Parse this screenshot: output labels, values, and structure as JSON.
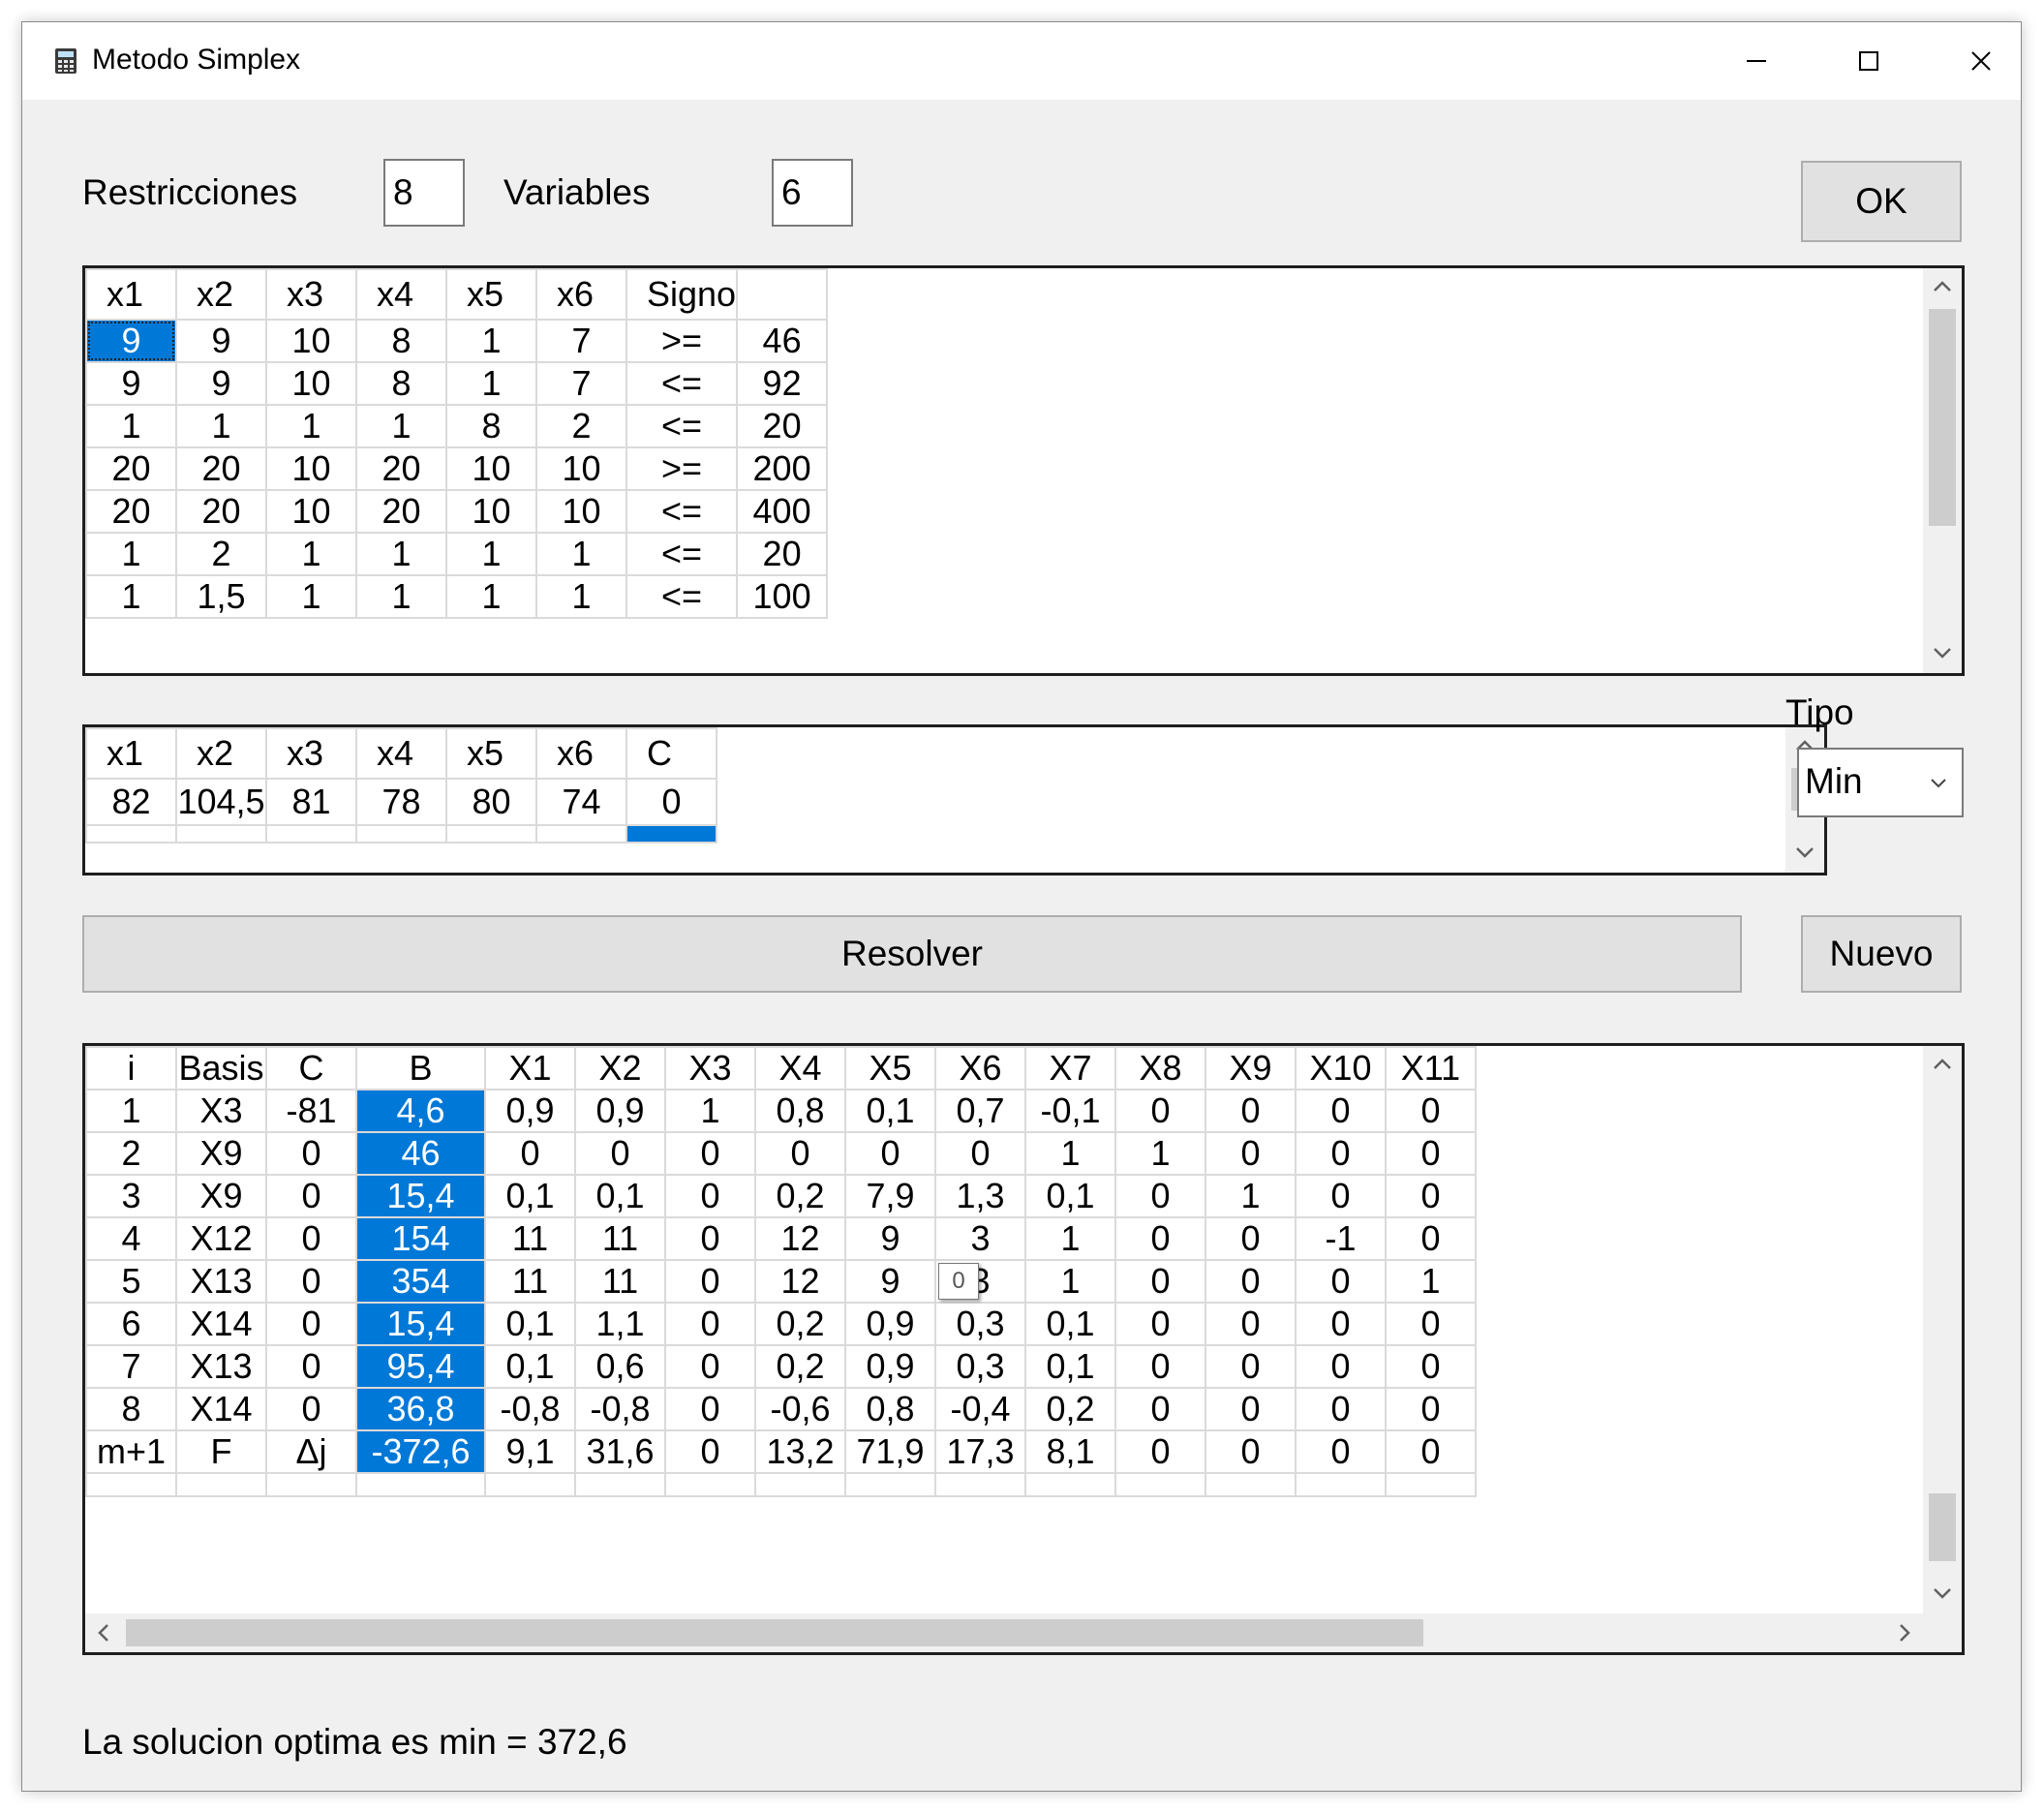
{
  "window": {
    "title": "Metodo Simplex",
    "minimize": "minimize",
    "maximize": "maximize",
    "close": "close"
  },
  "config": {
    "restricciones_label": "Restricciones",
    "restricciones_value": "8",
    "variables_label": "Variables",
    "variables_value": "6",
    "ok_label": "OK"
  },
  "constraints": {
    "headers": [
      "x1",
      "x2",
      "x3",
      "x4",
      "x5",
      "x6",
      "Signo",
      ""
    ],
    "rows": [
      [
        "9",
        "9",
        "10",
        "8",
        "1",
        "7",
        ">=",
        "46"
      ],
      [
        "9",
        "9",
        "10",
        "8",
        "1",
        "7",
        "<=",
        "92"
      ],
      [
        "1",
        "1",
        "1",
        "1",
        "8",
        "2",
        "<=",
        "20"
      ],
      [
        "20",
        "20",
        "10",
        "20",
        "10",
        "10",
        ">=",
        "200"
      ],
      [
        "20",
        "20",
        "10",
        "20",
        "10",
        "10",
        "<=",
        "400"
      ],
      [
        "1",
        "2",
        "1",
        "1",
        "1",
        "1",
        "<=",
        "20"
      ],
      [
        "1",
        "1,5",
        "1",
        "1",
        "1",
        "1",
        "<=",
        "100"
      ]
    ]
  },
  "objective": {
    "headers": [
      "x1",
      "x2",
      "x3",
      "x4",
      "x5",
      "x6",
      "C"
    ],
    "values": [
      "82",
      "104,5",
      "81",
      "78",
      "80",
      "74",
      "0"
    ]
  },
  "tipo": {
    "label": "Tipo",
    "selected": "Min"
  },
  "actions": {
    "resolver_label": "Resolver",
    "nuevo_label": "Nuevo"
  },
  "simplex": {
    "headers": [
      "i",
      "Basis",
      "C",
      "B",
      "X1",
      "X2",
      "X3",
      "X4",
      "X5",
      "X6",
      "X7",
      "X8",
      "X9",
      "X10",
      "X11"
    ],
    "rows": [
      [
        "1",
        "X3",
        "-81",
        "4,6",
        "0,9",
        "0,9",
        "1",
        "0,8",
        "0,1",
        "0,7",
        "-0,1",
        "0",
        "0",
        "0",
        "0"
      ],
      [
        "2",
        "X9",
        "0",
        "46",
        "0",
        "0",
        "0",
        "0",
        "0",
        "0",
        "1",
        "1",
        "0",
        "0",
        "0"
      ],
      [
        "3",
        "X9",
        "0",
        "15,4",
        "0,1",
        "0,1",
        "0",
        "0,2",
        "7,9",
        "1,3",
        "0,1",
        "0",
        "1",
        "0",
        "0"
      ],
      [
        "4",
        "X12",
        "0",
        "154",
        "11",
        "11",
        "0",
        "12",
        "9",
        "3",
        "1",
        "0",
        "0",
        "-1",
        "0"
      ],
      [
        "5",
        "X13",
        "0",
        "354",
        "11",
        "11",
        "0",
        "12",
        "9",
        "3",
        "1",
        "0",
        "0",
        "0",
        "1"
      ],
      [
        "6",
        "X14",
        "0",
        "15,4",
        "0,1",
        "1,1",
        "0",
        "0,2",
        "0,9",
        "0,3",
        "0,1",
        "0",
        "0",
        "0",
        "0"
      ],
      [
        "7",
        "X13",
        "0",
        "95,4",
        "0,1",
        "0,6",
        "0",
        "0,2",
        "0,9",
        "0,3",
        "0,1",
        "0",
        "0",
        "0",
        "0"
      ],
      [
        "8",
        "X14",
        "0",
        "36,8",
        "-0,8",
        "-0,8",
        "0",
        "-0,6",
        "0,8",
        "-0,4",
        "0,2",
        "0",
        "0",
        "0",
        "0"
      ],
      [
        "m+1",
        "F",
        "Δj",
        "-372,6",
        "9,1",
        "31,6",
        "0",
        "13,2",
        "71,9",
        "17,3",
        "8,1",
        "0",
        "0",
        "0",
        "0"
      ]
    ],
    "tooltip": "0"
  },
  "result_text": "La solucion optima es min = 372,6",
  "colors": {
    "selection": "#0078d7",
    "window_bg": "#f0f0f0",
    "button_bg": "#e1e1e1"
  }
}
